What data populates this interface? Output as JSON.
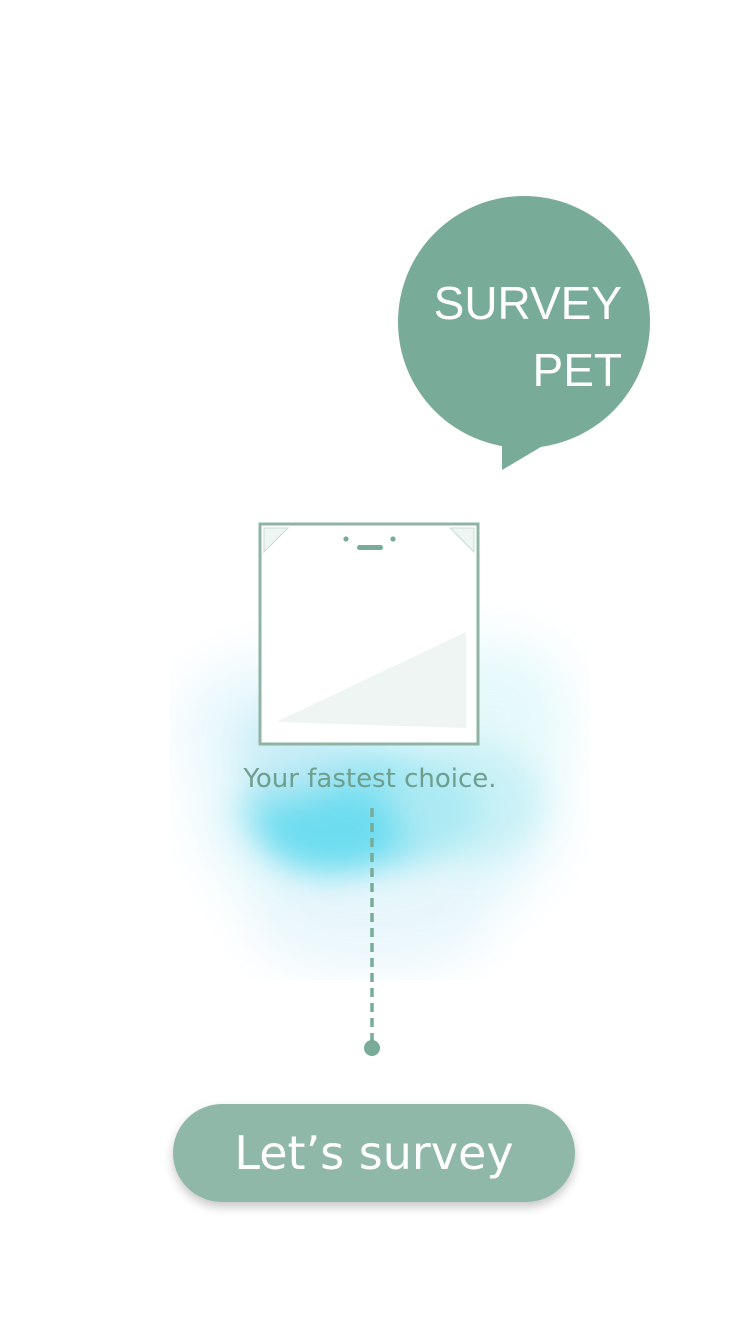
{
  "app": {
    "bubble": {
      "line1": "SURVEY",
      "line2": "PET"
    },
    "tagline": "Your fastest choice.",
    "cta_label": "Let’s survey"
  },
  "icons": {
    "phone": "phone-illustration-icon",
    "bubble": "speech-bubble-icon",
    "splash": "watercolor-splash-icon",
    "connector": "dotted-connector-icon"
  },
  "colors": {
    "brand": "#78ab98",
    "button": "#90b8a9",
    "text_muted": "#6f9e8e",
    "splash": "#5fd9ef",
    "white": "#ffffff"
  }
}
